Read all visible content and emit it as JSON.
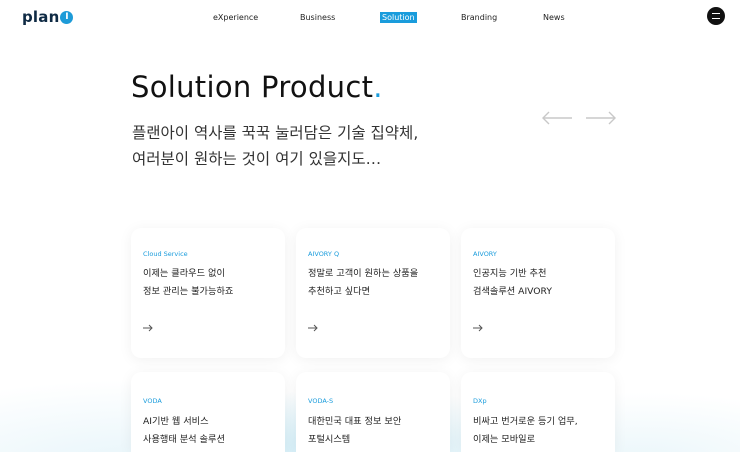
{
  "header": {
    "logo_text": "plan",
    "logo_mark": "I",
    "nav": [
      {
        "label": "eXperience",
        "active": false
      },
      {
        "label": "Business",
        "active": false
      },
      {
        "label": "Solution",
        "active": true
      },
      {
        "label": "Branding",
        "active": false
      },
      {
        "label": "News",
        "active": false
      }
    ],
    "menu_icon": "hamburger-icon"
  },
  "hero": {
    "title": "Solution Product",
    "title_accent": ".",
    "subtitle_lines": [
      "플랜아이 역사를 꾹꾹 눌러담은 기술 집약체,",
      "여러분이 원하는 것이 여기 있을지도…"
    ],
    "prev_icon": "arrow-left-icon",
    "next_icon": "arrow-right-icon"
  },
  "cards": [
    {
      "tag": "Cloud Service",
      "lines": [
        "이제는 클라우드 없이",
        "정보 관리는 불가능하죠"
      ],
      "icon": "arrow-right-icon"
    },
    {
      "tag": "AIVORY Q",
      "lines": [
        "정말로 고객이 원하는 상품을",
        "추천하고 싶다면"
      ],
      "icon": "arrow-right-icon"
    },
    {
      "tag": "AIVORY",
      "lines": [
        "인공지능 기반 추천",
        "검색솔루션 AIVORY"
      ],
      "icon": "arrow-right-icon"
    },
    {
      "tag": "VODA",
      "lines": [
        "AI기반 웹 서비스",
        "사용행태 분석 솔루션"
      ]
    },
    {
      "tag": "VODA-S",
      "lines": [
        "대한민국 대표 정보 보안",
        "포털시스템"
      ]
    },
    {
      "tag": "DXp",
      "lines": [
        "비싸고 번거로운 등기 업무,",
        "이제는 모바일로"
      ]
    }
  ],
  "colors": {
    "accent": "#1a9cdc",
    "text": "#111111",
    "arrow": "#c8c8c8"
  }
}
